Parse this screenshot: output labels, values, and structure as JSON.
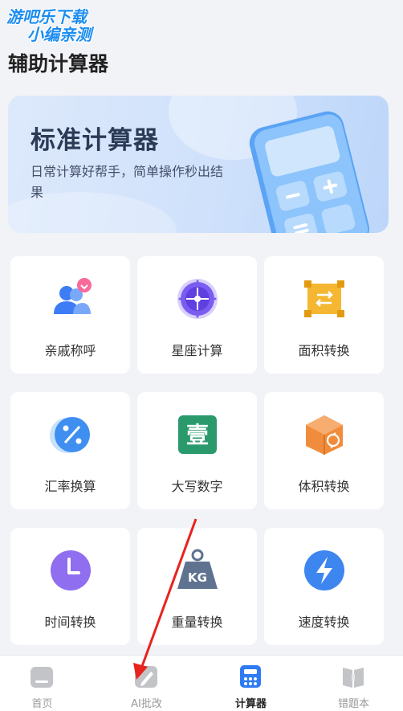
{
  "watermark": {
    "line1": "游吧乐下载",
    "line2": "小编亲测"
  },
  "page_title": "辅助计算器",
  "banner": {
    "title": "标准计算器",
    "subtitle": "日常计算好帮手，简单操作秒出结果"
  },
  "tools": [
    {
      "label": "亲戚称呼",
      "icon": "relatives-icon",
      "color": "#3d7cf4"
    },
    {
      "label": "星座计算",
      "icon": "constellation-icon",
      "color": "#7b5cf0"
    },
    {
      "label": "面积转换",
      "icon": "area-icon",
      "color": "#f5b731"
    },
    {
      "label": "汇率换算",
      "icon": "exchange-rate-icon",
      "color": "#3f8ff0"
    },
    {
      "label": "大写数字",
      "icon": "uppercase-number-icon",
      "color": "#2a9a6c"
    },
    {
      "label": "体积转换",
      "icon": "volume-icon",
      "color": "#f08c3b"
    },
    {
      "label": "时间转换",
      "icon": "clock-icon",
      "color": "#8f6ef0"
    },
    {
      "label": "重量转换",
      "icon": "weight-icon",
      "color": "#5f7390"
    },
    {
      "label": "速度转换",
      "icon": "lightning-icon",
      "color": "#3d86f0"
    }
  ],
  "glyphs": {
    "uppercase_char": "壹",
    "weight_unit": "KG"
  },
  "tabs": [
    {
      "label": "首页",
      "icon": "home-icon",
      "active": false
    },
    {
      "label": "AI批改",
      "icon": "pen-icon",
      "active": false
    },
    {
      "label": "计算器",
      "icon": "calculator-icon",
      "active": true
    },
    {
      "label": "错题本",
      "icon": "book-icon",
      "active": false
    }
  ],
  "colors": {
    "active_tab": "#2f7bf5",
    "inactive_tab": "#c2c4c8",
    "annotation_arrow": "#e8231e"
  }
}
